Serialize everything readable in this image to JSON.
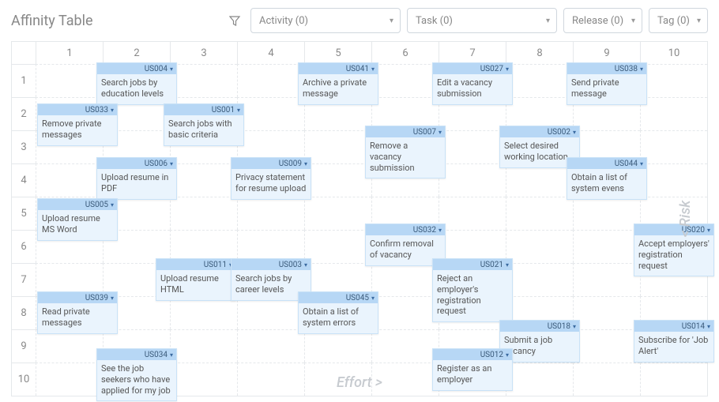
{
  "title": "Affinity Table",
  "filters": {
    "activity": "Activity (0)",
    "task": "Task (0)",
    "release": "Release (0)",
    "tag": "Tag (0)"
  },
  "axes": {
    "x": "Effort >",
    "y": "< Risk"
  },
  "grid": {
    "cols": 10,
    "rows": 10
  },
  "cards": [
    {
      "id": "US004",
      "text": "Search jobs by education levels",
      "col": 2,
      "row": 1
    },
    {
      "id": "US041",
      "text": "Archive a private message",
      "col": 5,
      "row": 1
    },
    {
      "id": "US027",
      "text": "Edit a vacancy submission",
      "col": 7,
      "row": 1
    },
    {
      "id": "US038",
      "text": "Send private message",
      "col": 9,
      "row": 1
    },
    {
      "id": "US033",
      "text": "Remove private messages",
      "col": 1,
      "row": 2,
      "ox": 10,
      "oy": 10
    },
    {
      "id": "US001",
      "text": "Search jobs with basic criteria",
      "col": 3,
      "row": 2,
      "oy": 10
    },
    {
      "id": "US002",
      "text": "Select desired working location",
      "col": 8,
      "row": 3,
      "oy": -4
    },
    {
      "id": "US007",
      "text": "Remove a vacancy submission",
      "col": 6,
      "row": 3,
      "oy": -4
    },
    {
      "id": "US006",
      "text": "Upload resume in PDF",
      "col": 2,
      "row": 4,
      "oy": -6
    },
    {
      "id": "US009",
      "text": "Privacy statement for resume upload",
      "col": 4,
      "row": 4,
      "oy": -6
    },
    {
      "id": "US044",
      "text": "Obtain a list of system evens",
      "col": 9,
      "row": 4,
      "oy": -6
    },
    {
      "id": "US005",
      "text": "Upload resume MS Word",
      "col": 1,
      "row": 5,
      "ox": 10,
      "oy": 4
    },
    {
      "id": "US032",
      "text": "Confirm removal of vacancy",
      "col": 6,
      "row": 6,
      "oy": -6
    },
    {
      "id": "US020",
      "text": "Accept employers' registration request",
      "col": 10,
      "row": 6,
      "oy": -6
    },
    {
      "id": "US011",
      "text": "Upload resume HTML",
      "col": 3,
      "row": 7,
      "ox": -10,
      "oy": -4
    },
    {
      "id": "US003",
      "text": "Search jobs by career levels",
      "col": 4,
      "row": 7,
      "oy": -4
    },
    {
      "id": "US021",
      "text": "Reject an employer's registration request",
      "col": 7,
      "row": 7,
      "oy": -4
    },
    {
      "id": "US039",
      "text": "Read private messages",
      "col": 1,
      "row": 8,
      "ox": 10,
      "oy": -4
    },
    {
      "id": "US045",
      "text": "Obtain a list of system errors",
      "col": 5,
      "row": 8,
      "oy": -4
    },
    {
      "id": "US018",
      "text": "Submit a job vacancy",
      "col": 8,
      "row": 9,
      "oy": -10
    },
    {
      "id": "US014",
      "text": "Subscribe for 'Job Alert'",
      "col": 10,
      "row": 9,
      "oy": -10
    },
    {
      "id": "US034",
      "text": "See the job seekers who have applied for my job",
      "col": 2,
      "row": 10,
      "oy": -16
    },
    {
      "id": "US012",
      "text": "Register as an employer",
      "col": 7,
      "row": 10,
      "oy": -16
    }
  ]
}
